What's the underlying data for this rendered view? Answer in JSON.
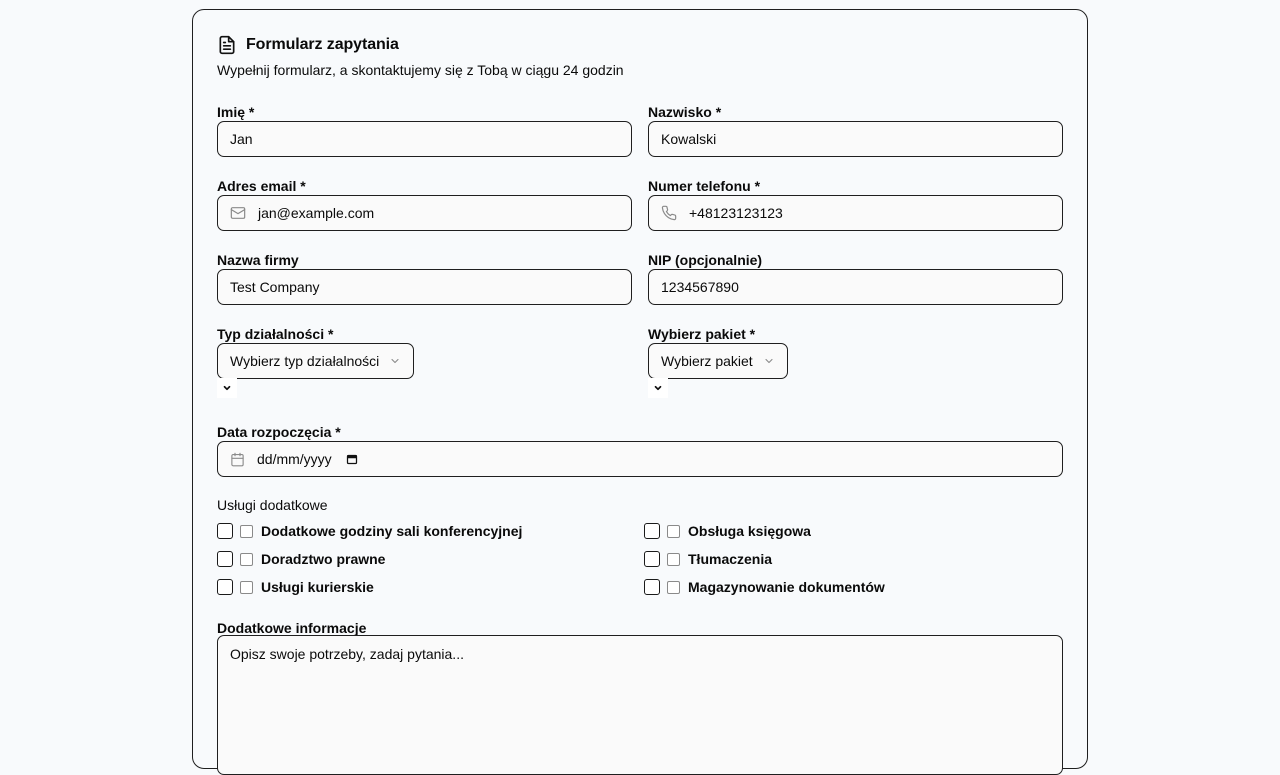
{
  "form": {
    "title": "Formularz zapytania",
    "subtitle": "Wypełnij formularz, a skontaktujemy się z Tobą w ciągu 24 godzin",
    "first_name": {
      "label": "Imię *",
      "value": "Jan"
    },
    "last_name": {
      "label": "Nazwisko *",
      "value": "Kowalski"
    },
    "email": {
      "label": "Adres email *",
      "value": "jan@example.com",
      "icon": "mail-icon"
    },
    "phone": {
      "label": "Numer telefonu *",
      "value": "+48123123123",
      "icon": "phone-icon"
    },
    "company": {
      "label": "Nazwa firmy",
      "value": "Test Company"
    },
    "nip": {
      "label": "NIP (opcjonalnie)",
      "value": "1234567890"
    },
    "business_type": {
      "label": "Typ działalności *",
      "value": "Wybierz typ działalności"
    },
    "package": {
      "label": "Wybierz pakiet *",
      "value": "Wybierz pakiet"
    },
    "start_date": {
      "label": "Data rozpoczęcia *",
      "value": "dd/mm/yyyy",
      "icon": "calendar-icon"
    },
    "services": {
      "label": "Usługi dodatkowe",
      "items": [
        {
          "label": "Dodatkowe godziny sali konferencyjnej",
          "checked": false
        },
        {
          "label": "Obsługa księgowa",
          "checked": false
        },
        {
          "label": "Doradztwo prawne",
          "checked": false
        },
        {
          "label": "Tłumaczenia",
          "checked": false
        },
        {
          "label": "Usługi kurierskie",
          "checked": false
        },
        {
          "label": "Magazynowanie dokumentów",
          "checked": false
        }
      ]
    },
    "notes": {
      "label": "Dodatkowe informacje",
      "placeholder": "Opisz swoje potrzeby, zadaj pytania..."
    }
  }
}
